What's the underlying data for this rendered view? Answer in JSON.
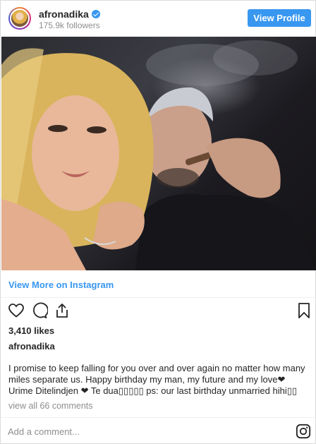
{
  "header": {
    "username": "afronadika",
    "followers": "175.9k followers",
    "view_profile_label": "View Profile"
  },
  "main": {
    "view_more_label": "View More on Instagram",
    "likes": "3,410 likes",
    "poster_username": "afronadika",
    "caption": "I promise to keep falling for you over and over again no matter how many miles separate us. Happy birthday my man, my future and my love❤ Urime Ditelindjen ❤ Te dua▯▯▯▯▯ ps: our last birthday unmarried hihi▯▯",
    "comments_link": "view all 66 comments"
  },
  "footer": {
    "add_comment_placeholder": "Add a comment..."
  },
  "icons": [
    "verified-badge-icon",
    "heart-icon",
    "comment-icon",
    "share-icon",
    "bookmark-icon",
    "instagram-icon"
  ],
  "colors": {
    "accent": "#3897f0",
    "text": "#262626",
    "muted": "#8e8e8e",
    "divider": "#efefef"
  }
}
